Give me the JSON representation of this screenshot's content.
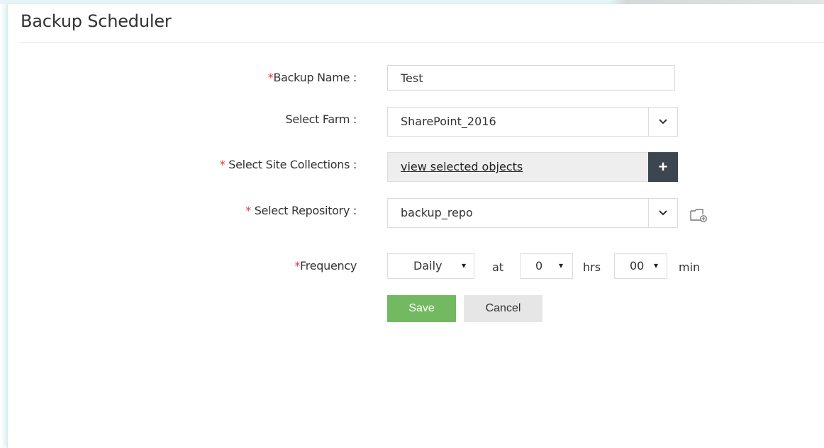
{
  "page": {
    "title": "Backup Scheduler"
  },
  "form": {
    "required_mark": "*",
    "backup_name": {
      "label": "Backup Name :",
      "value": "Test"
    },
    "farm": {
      "label": "Select Farm :",
      "value": "SharePoint_2016"
    },
    "site_collections": {
      "label": " Select Site Collections :",
      "link": "view selected objects",
      "add_label": "+"
    },
    "repository": {
      "label": " Select Repository :",
      "value": "backup_repo"
    },
    "frequency": {
      "label": "Frequency",
      "period": "Daily",
      "at_text": "at",
      "hours": "0",
      "hrs_text": "hrs",
      "minutes": "00",
      "min_text": "min",
      "dropdown_glyph": "▾"
    },
    "actions": {
      "save_label": "Save",
      "cancel_label": "Cancel"
    }
  },
  "icons": {
    "dropdown": "chevron-down-icon",
    "add_repo": "folder-add-icon"
  },
  "colors": {
    "required": "#e53935",
    "save": "#73b961",
    "plus_button": "#3c4650"
  }
}
